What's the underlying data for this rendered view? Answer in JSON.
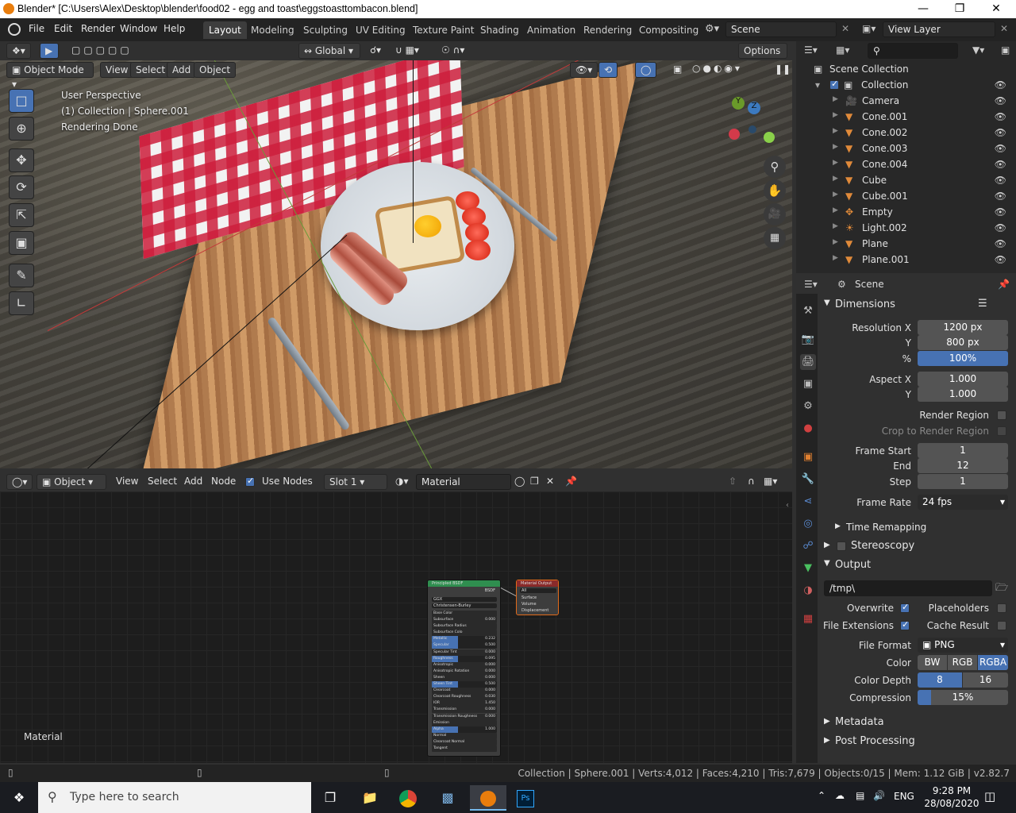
{
  "window": {
    "title": "Blender* [C:\\Users\\Alex\\Desktop\\blender\\food02 - egg and toast\\eggstoasttombacon.blend]"
  },
  "menu": [
    "File",
    "Edit",
    "Render",
    "Window",
    "Help"
  ],
  "workspaces": [
    "Layout",
    "Modeling",
    "Sculpting",
    "UV Editing",
    "Texture Paint",
    "Shading",
    "Animation",
    "Rendering",
    "Compositing"
  ],
  "scene_selector": {
    "value": "Scene"
  },
  "view_layer_selector": {
    "value": "View Layer"
  },
  "viewport": {
    "transform_orientation": "Global",
    "options_label": "Options",
    "mode": "Object Mode",
    "header_menus": [
      "View",
      "Select",
      "Add",
      "Object"
    ],
    "overlay_lines": [
      "User Perspective",
      "(1) Collection | Sphere.001",
      "Rendering Done"
    ]
  },
  "node_editor": {
    "editor_type": "Object",
    "menus": [
      "View",
      "Select",
      "Add",
      "Node"
    ],
    "use_nodes_label": "Use Nodes",
    "slot": "Slot 1",
    "material": "Material",
    "corner_label": "Material",
    "principled_node": {
      "title": "Principled BSDF",
      "output": "BSDF",
      "distribution": "GGX",
      "subsurface_method": "Christensen-Burley",
      "inputs": [
        {
          "name": "Base Color",
          "value": ""
        },
        {
          "name": "Subsurface",
          "value": "0.000"
        },
        {
          "name": "Subsurface Radius",
          "value": ""
        },
        {
          "name": "Subsurface Colo",
          "value": ""
        },
        {
          "name": "Metallic",
          "value": "0.232"
        },
        {
          "name": "Specular",
          "value": "0.500"
        },
        {
          "name": "Specular Tint",
          "value": "0.000"
        },
        {
          "name": "Roughness",
          "value": "0.095"
        },
        {
          "name": "Anisotropic",
          "value": "0.000"
        },
        {
          "name": "Anisotropic Rotation",
          "value": "0.000"
        },
        {
          "name": "Sheen",
          "value": "0.000"
        },
        {
          "name": "Sheen Tint",
          "value": "0.500"
        },
        {
          "name": "Clearcoat",
          "value": "0.000"
        },
        {
          "name": "Clearcoat Roughness",
          "value": "0.030"
        },
        {
          "name": "IOR",
          "value": "1.450"
        },
        {
          "name": "Transmission",
          "value": "0.000"
        },
        {
          "name": "Transmission Roughness",
          "value": "0.000"
        },
        {
          "name": "Emission",
          "value": ""
        },
        {
          "name": "Alpha",
          "value": "1.000"
        },
        {
          "name": "Normal",
          "value": ""
        },
        {
          "name": "Clearcoat Normal",
          "value": ""
        },
        {
          "name": "Tangent",
          "value": ""
        }
      ]
    },
    "output_node": {
      "title": "Material Output",
      "target": "All",
      "inputs": [
        "Surface",
        "Volume",
        "Displacement"
      ]
    }
  },
  "outliner": {
    "root": "Scene Collection",
    "collection": "Collection",
    "items": [
      "Camera",
      "Cone.001",
      "Cone.002",
      "Cone.003",
      "Cone.004",
      "Cube",
      "Cube.001",
      "Empty",
      "Light.002",
      "Plane",
      "Plane.001"
    ]
  },
  "properties": {
    "context": "Scene",
    "dimensions": {
      "header": "Dimensions",
      "resolution_x_label": "Resolution X",
      "resolution_x": "1200 px",
      "y_label": "Y",
      "resolution_y": "800 px",
      "pct_label": "%",
      "resolution_pct": "100%",
      "aspect_x_label": "Aspect X",
      "aspect_x": "1.000",
      "aspect_y_label": "Y",
      "aspect_y": "1.000",
      "render_region": "Render Region",
      "crop_region": "Crop to Render Region",
      "frame_start_label": "Frame Start",
      "frame_start": "1",
      "end_label": "End",
      "frame_end": "12",
      "step_label": "Step",
      "frame_step": "1",
      "frame_rate_label": "Frame Rate",
      "frame_rate": "24 fps",
      "time_remapping": "Time Remapping"
    },
    "stereoscopy": "Stereoscopy",
    "output": {
      "header": "Output",
      "path": "/tmp\\",
      "overwrite": "Overwrite",
      "placeholders": "Placeholders",
      "file_extensions": "File Extensions",
      "cache_result": "Cache Result",
      "file_format_label": "File Format",
      "file_format": "PNG",
      "color_label": "Color",
      "color_options": [
        "BW",
        "RGB",
        "RGBA"
      ],
      "color_depth_label": "Color Depth",
      "color_depth_options": [
        "8",
        "16"
      ],
      "compression_label": "Compression",
      "compression": "15%"
    },
    "metadata": "Metadata",
    "post_processing": "Post Processing"
  },
  "statusbar": {
    "text": "Collection | Sphere.001 | Verts:4,012 | Faces:4,210 | Tris:7,679 | Objects:0/15 | Mem: 1.12 GiB | v2.82.7"
  },
  "taskbar": {
    "search_placeholder": "Type here to search",
    "language": "ENG",
    "time": "9:28 PM",
    "date": "28/08/2020"
  }
}
